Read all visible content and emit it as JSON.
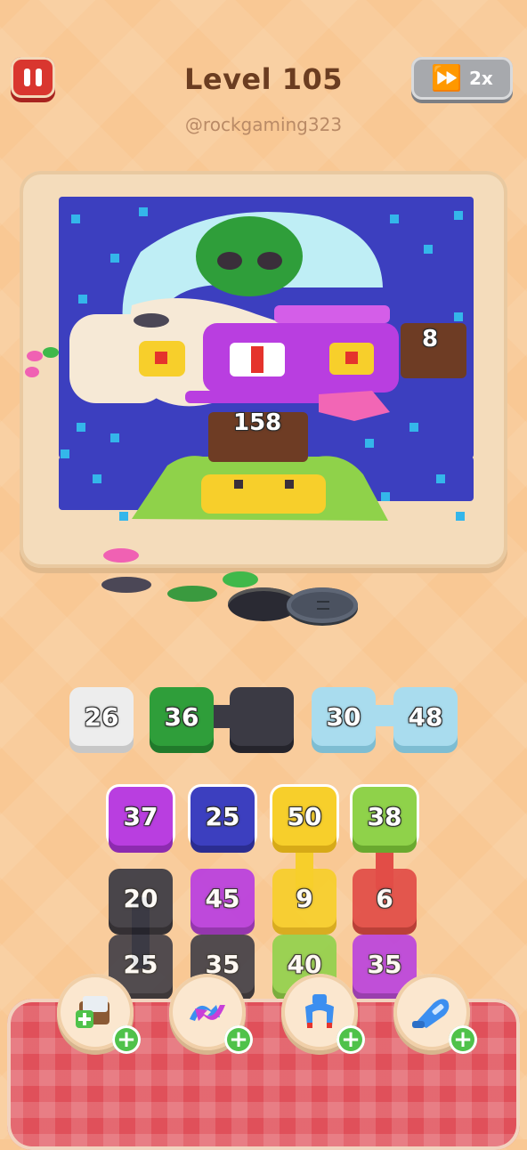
{
  "header": {
    "level_title": "Level 105",
    "username": "@rockgaming323",
    "speed_label": "2x"
  },
  "board": {
    "block_counts": [
      {
        "id": "right-block",
        "value": "8"
      },
      {
        "id": "center-block",
        "value": "158"
      }
    ]
  },
  "queue_row": [
    "26",
    "36",
    "",
    "30",
    "48"
  ],
  "grid": {
    "row1": [
      "37",
      "25",
      "50",
      "38"
    ],
    "row2": [
      "20",
      "45",
      "9",
      "6"
    ],
    "row3": [
      "25",
      "35",
      "40",
      "35"
    ]
  },
  "tools": [
    "add-tray-icon",
    "shuffle-icon",
    "magnet-claw-icon",
    "vacuum-icon"
  ],
  "colors": {
    "background": "#f9c894",
    "pause": "#d9362f",
    "purple": "#b93ee0",
    "navy": "#3c3fbf",
    "yellow": "#f7cf2b",
    "lime": "#8fd24a",
    "green": "#2f9e3a",
    "charcoal": "#3b3a44",
    "red": "#e24d47",
    "white": "#eeeeee",
    "skyblue": "#a9dcee"
  }
}
